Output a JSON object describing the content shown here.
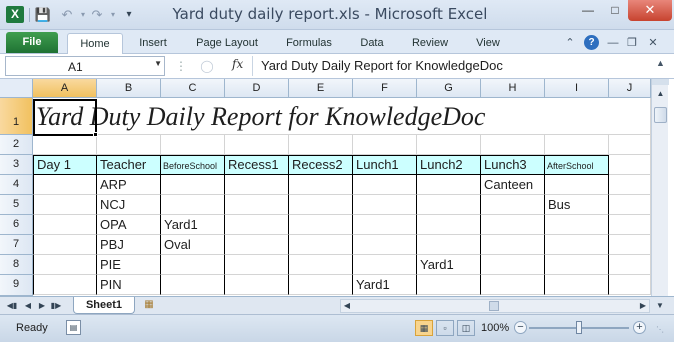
{
  "window": {
    "title": "Yard duty daily report.xls - Microsoft Excel",
    "app_icon": "excel-icon",
    "minimize_icon": "minimize-icon",
    "maximize_icon": "maximize-icon",
    "close_icon": "close-icon"
  },
  "ribbon": {
    "file_label": "File",
    "tabs": [
      "Home",
      "Insert",
      "Page Layout",
      "Formulas",
      "Data",
      "Review",
      "View"
    ],
    "active_tab": "Home"
  },
  "formula_bar": {
    "name_box": "A1",
    "fx_label": "fx",
    "content": "Yard Duty Daily Report for KnowledgeDoc"
  },
  "sheet": {
    "column_headers": [
      "A",
      "B",
      "C",
      "D",
      "E",
      "F",
      "G",
      "H",
      "I",
      "J"
    ],
    "row_headers": [
      "1",
      "2",
      "3",
      "4",
      "5",
      "6",
      "7",
      "8",
      "9"
    ],
    "selected_cell": "A1",
    "title": "Yard Duty Daily Report for KnowledgeDoc",
    "header_row": [
      "Day 1",
      "Teacher",
      "BeforeSchool",
      "Recess1",
      "Recess2",
      "Lunch1",
      "Lunch2",
      "Lunch3",
      "AfterSchool"
    ],
    "header_fill": "#ccffff",
    "rows": [
      {
        "teacher": "ARP",
        "BeforeSchool": "",
        "Lunch1": "",
        "Lunch2": "",
        "Lunch3": "Canteen",
        "AfterSchool": ""
      },
      {
        "teacher": "NCJ",
        "BeforeSchool": "",
        "Lunch1": "",
        "Lunch2": "",
        "Lunch3": "",
        "AfterSchool": "Bus"
      },
      {
        "teacher": "OPA",
        "BeforeSchool": "Yard1",
        "Lunch1": "",
        "Lunch2": "",
        "Lunch3": "",
        "AfterSchool": ""
      },
      {
        "teacher": "PBJ",
        "BeforeSchool": "Oval",
        "Lunch1": "",
        "Lunch2": "",
        "Lunch3": "",
        "AfterSchool": ""
      },
      {
        "teacher": "PIE",
        "BeforeSchool": "",
        "Lunch1": "",
        "Lunch2": "Yard1",
        "Lunch3": "",
        "AfterSchool": ""
      },
      {
        "teacher": "PIN",
        "BeforeSchool": "",
        "Lunch1": "Yard1",
        "Lunch2": "",
        "Lunch3": "",
        "AfterSchool": ""
      }
    ]
  },
  "sheet_tabs": [
    "Sheet1"
  ],
  "status_bar": {
    "status": "Ready",
    "zoom": "100%",
    "zoom_level": 1.0
  },
  "colors": {
    "file_tab": "#1f7233",
    "selected_header": "#f1c15f",
    "close_button": "#c7432f"
  }
}
